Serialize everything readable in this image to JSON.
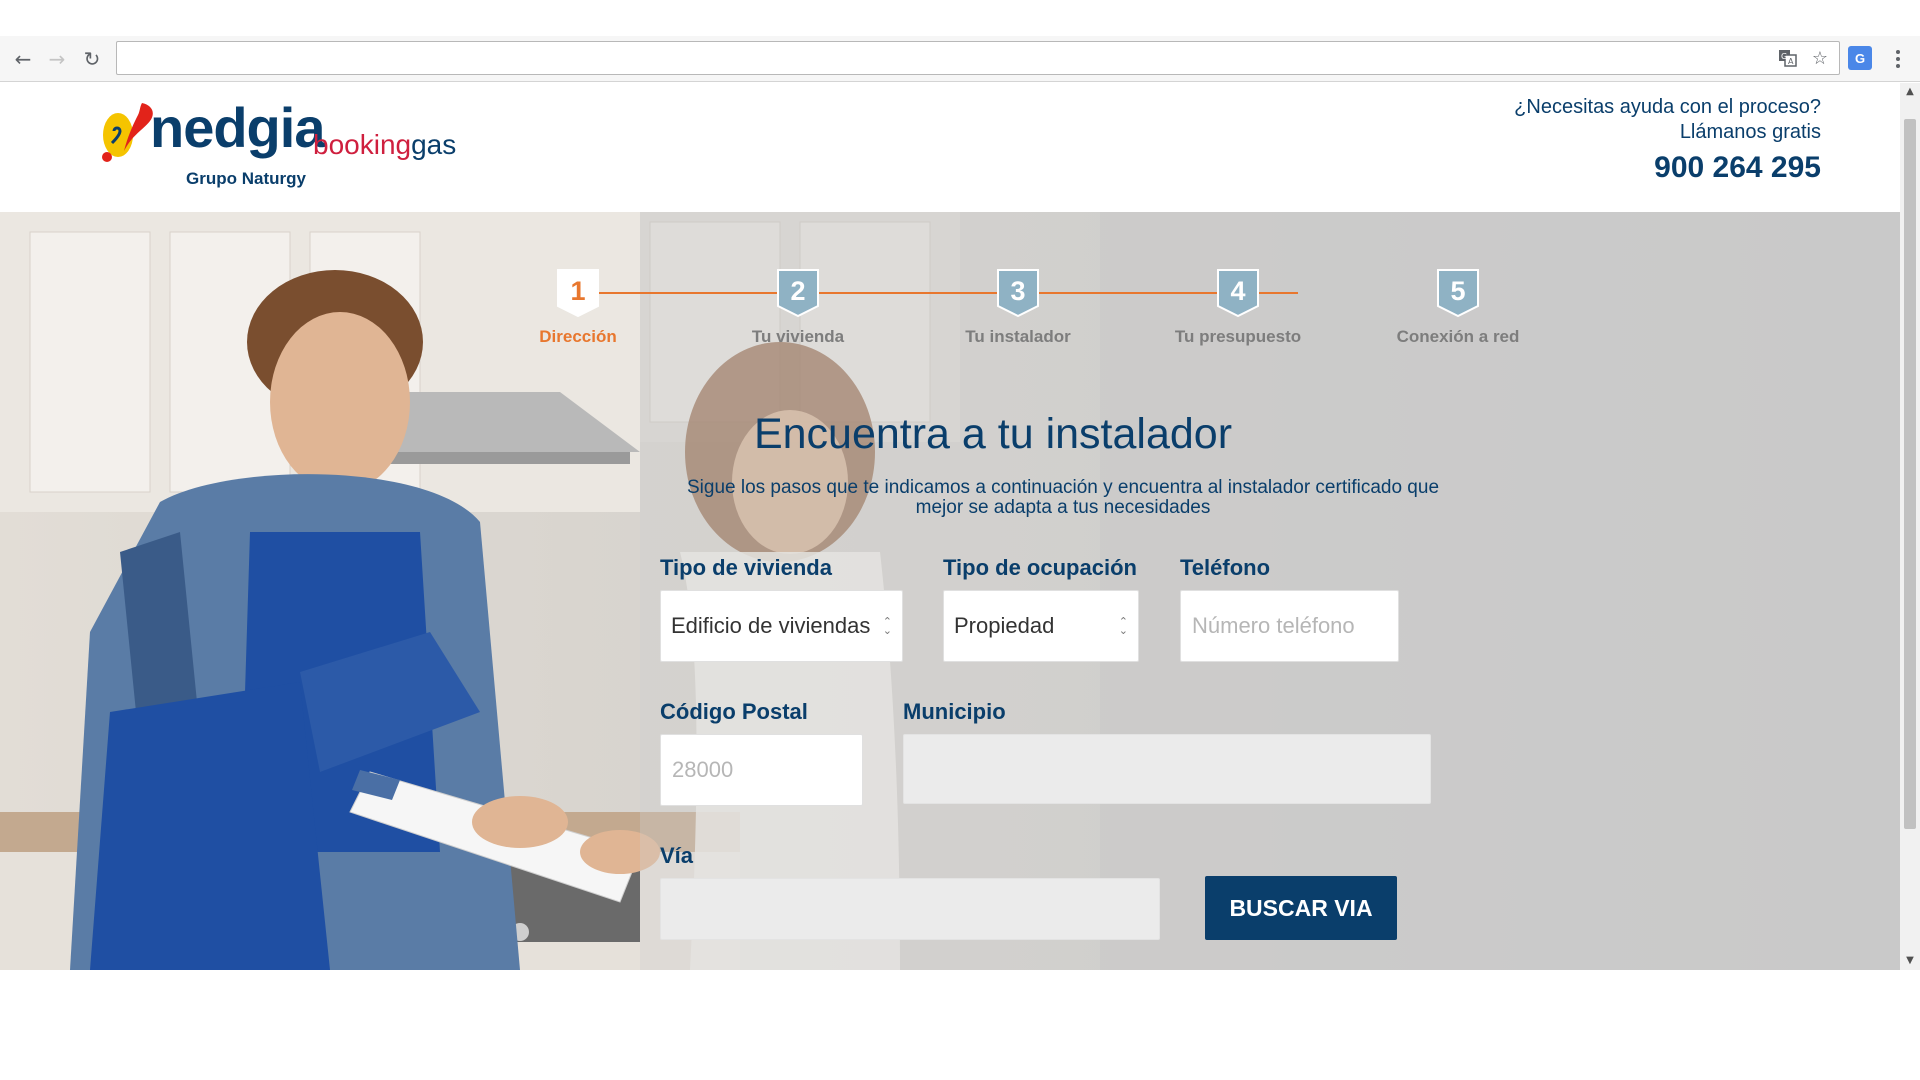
{
  "browser": {
    "url": "",
    "icons": [
      "back-arrow-icon",
      "forward-arrow-icon",
      "reload-icon",
      "translate-icon",
      "star-icon",
      "google-translate-extension-icon",
      "menu-icon"
    ]
  },
  "header": {
    "logo": {
      "name": "nedgia",
      "booking": "booking",
      "gas": "gas",
      "group": "Grupo Naturgy"
    },
    "help_line1": "¿Necesitas ayuda con el proceso?",
    "help_line2": "Llámanos gratis",
    "phone": "900 264 295"
  },
  "steps": [
    {
      "number": "1",
      "label": "Dirección",
      "active": true
    },
    {
      "number": "2",
      "label": "Tu vivienda",
      "active": false
    },
    {
      "number": "3",
      "label": "Tu instalador",
      "active": false
    },
    {
      "number": "4",
      "label": "Tu presupuesto",
      "active": false
    },
    {
      "number": "5",
      "label": "Conexión a red",
      "active": false
    }
  ],
  "form": {
    "title": "Encuentra a tu instalador",
    "subtitle_line1": "Sigue los pasos que te indicamos a continuación y encuentra al instalador certificado que",
    "subtitle_line2": "mejor se adapta a tus necesidades",
    "tipo_vivienda": {
      "label": "Tipo de vivienda",
      "value": "Edificio de viviendas"
    },
    "tipo_ocupacion": {
      "label": "Tipo de ocupación",
      "value": "Propiedad"
    },
    "telefono": {
      "label": "Teléfono",
      "placeholder": "Número teléfono",
      "value": ""
    },
    "codigo_postal": {
      "label": "Código Postal",
      "placeholder": "28000",
      "value": ""
    },
    "municipio": {
      "label": "Municipio",
      "value": ""
    },
    "via": {
      "label": "Vía",
      "value": ""
    },
    "buscar_label": "BUSCAR VIA"
  },
  "colors": {
    "primary": "#0a3e6b",
    "accent": "#e8772e",
    "brand_red": "#cf1f3e",
    "step_inactive": "#8fb2c4"
  }
}
